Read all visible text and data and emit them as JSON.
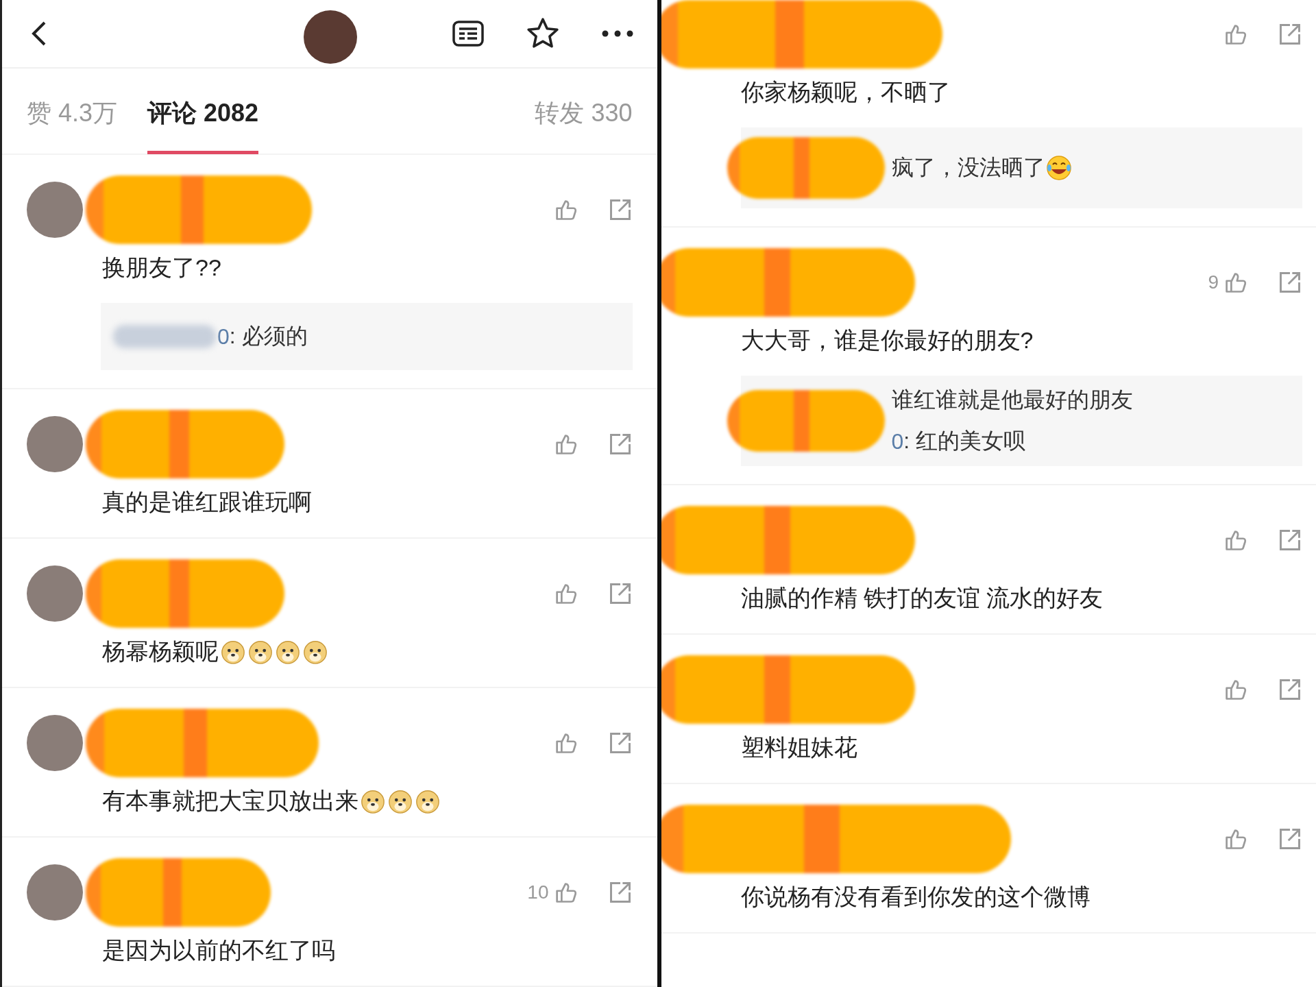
{
  "left_panel": {
    "tabs": [
      {
        "label": "赞 4.3万",
        "selected": false
      },
      {
        "label": "评论 2082",
        "selected": true
      },
      {
        "label": "转发 330",
        "selected": false
      }
    ],
    "comments": [
      {
        "text": "换朋友了??",
        "reply": {
          "lines": [
            {
              "name_tail": "0",
              "text": ": 必须的"
            }
          ]
        }
      },
      {
        "text": "真的是谁红跟谁玩啊"
      },
      {
        "text": "杨幂杨颖呢",
        "emojis": [
          {
            "kind": "doge"
          },
          {
            "kind": "doge"
          },
          {
            "kind": "doge"
          },
          {
            "kind": "doge"
          }
        ]
      },
      {
        "text": "有本事就把大宝贝放出来",
        "emojis": [
          {
            "kind": "doge"
          },
          {
            "kind": "doge"
          },
          {
            "kind": "doge"
          }
        ]
      },
      {
        "text": "是因为以前的不红了吗",
        "like_count": "10"
      }
    ]
  },
  "right_panel": {
    "comments": [
      {
        "text": "你家杨颖呢，不晒了",
        "reply": {
          "lines": [
            {
              "text": "疯了，没法晒了",
              "emojis": [
                {
                  "kind": "laugh"
                }
              ]
            }
          ]
        }
      },
      {
        "text": "大大哥，谁是你最好的朋友?",
        "like_count": "9",
        "reply": {
          "lines": [
            {
              "text": "谁红谁就是他最好的朋友"
            },
            {
              "name_tail": "0",
              "text": ": 红的美女呗"
            }
          ]
        }
      },
      {
        "text": "油腻的作精 铁打的友谊 流水的好友"
      },
      {
        "text": "塑料姐妹花"
      },
      {
        "text": "你说杨有没有看到你发的这个微博"
      }
    ]
  }
}
